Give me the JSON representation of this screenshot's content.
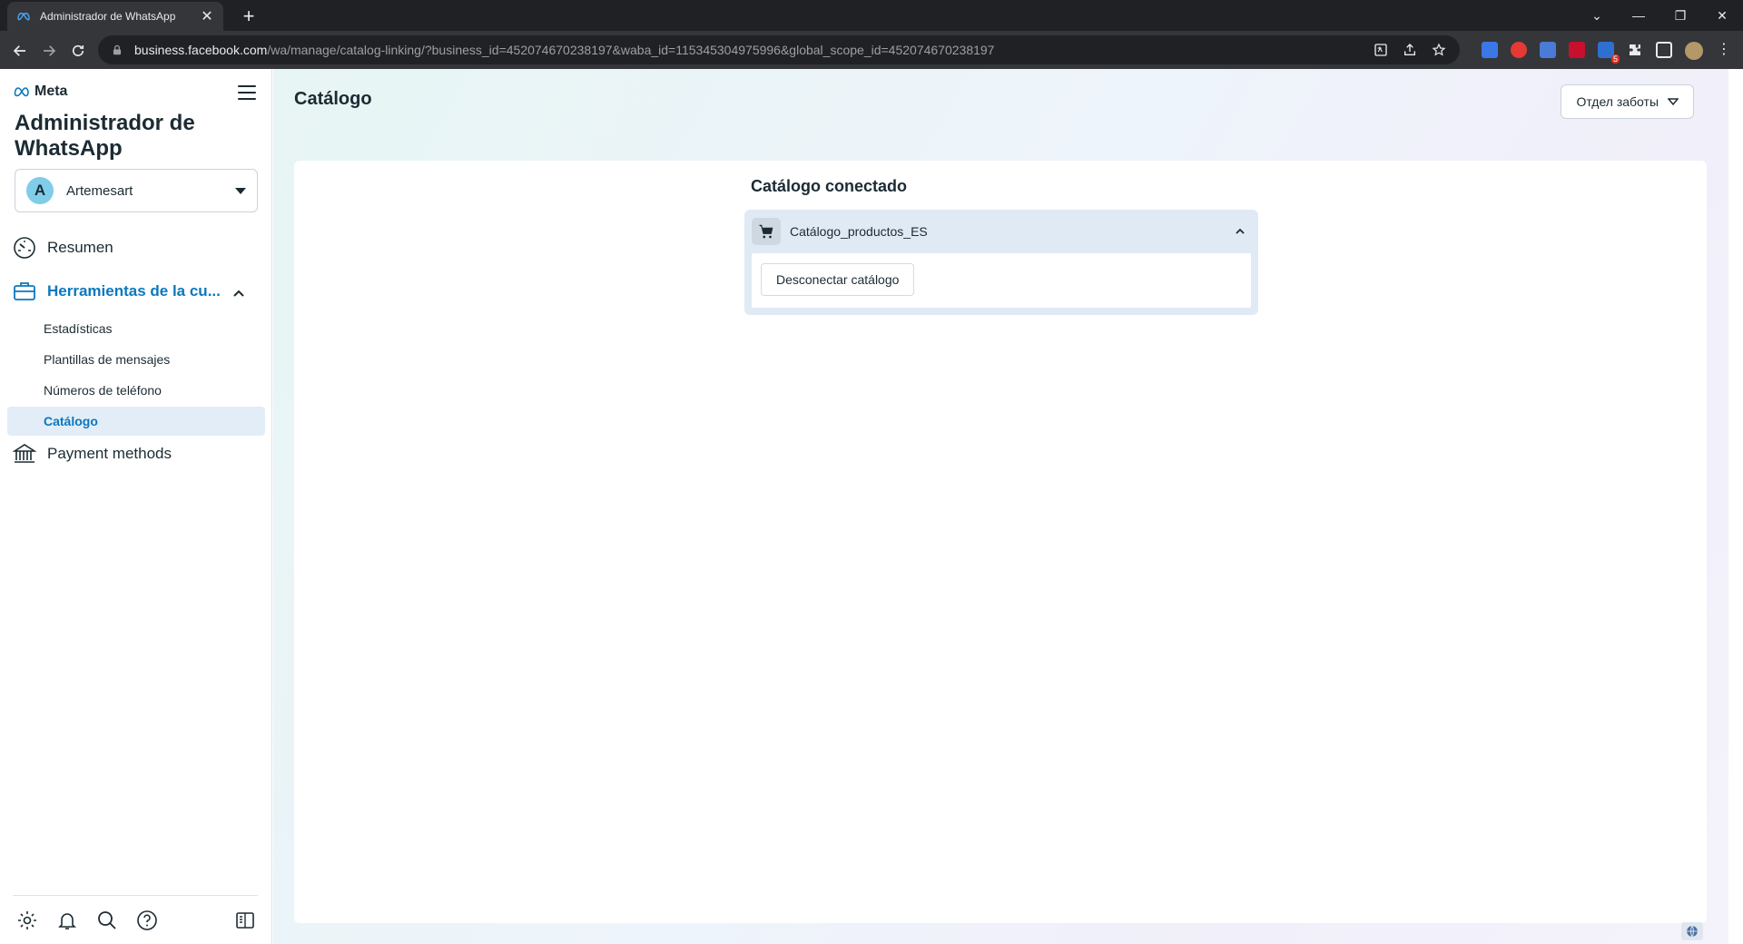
{
  "browser": {
    "tab_title": "Administrador de WhatsApp",
    "url_host": "business.facebook.com",
    "url_path": "/wa/manage/catalog-linking/?business_id=452074670238197&waba_id=115345304975996&global_scope_id=452074670238197",
    "extension_badge": "5"
  },
  "sidebar": {
    "logo_text": "Meta",
    "app_title": "Administrador de WhatsApp",
    "account": {
      "initial": "A",
      "name": "Artemesart"
    },
    "nav": {
      "overview": "Resumen",
      "tools": "Herramientas de la cu...",
      "payment": "Payment methods"
    },
    "sub_items": {
      "stats": "Estadísticas",
      "templates": "Plantillas de mensajes",
      "phones": "Números de teléfono",
      "catalog": "Catálogo"
    }
  },
  "main": {
    "page_title": "Catálogo",
    "department_button": "Отдел заботы",
    "card_title": "Catálogo conectado",
    "catalog_name": "Catálogo_productos_ES",
    "disconnect_label": "Desconectar catálogo"
  },
  "colors": {
    "accent": "#0a78be",
    "active_bg": "#e2edf7",
    "text": "#1c2b33"
  }
}
